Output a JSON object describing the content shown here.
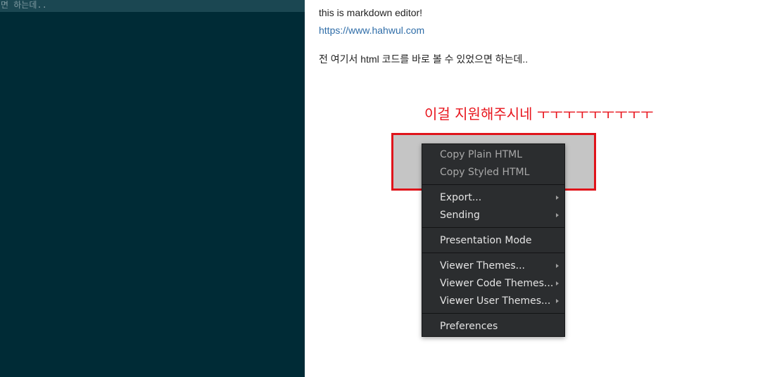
{
  "editor": {
    "visible_line": "면 하는데.."
  },
  "preview": {
    "line1": "this is markdown editor!",
    "link": "https://www.hahwul.com",
    "line2": "전 여기서 html 코드를 바로 볼 수 있었으면 하는데..",
    "annotation": "이걸 지원해주시네 ㅜㅜㅜㅜㅜㅜㅜㅜㅜ"
  },
  "colors": {
    "editor_bg": "#002b36",
    "annotation": "#e8141c",
    "highlight_border": "#e0141b",
    "menu_bg": "#2b2d2f"
  },
  "context_menu": {
    "copy_plain_html": "Copy Plain HTML",
    "copy_styled_html": "Copy Styled HTML",
    "export": "Export...",
    "sending": "Sending",
    "presentation_mode": "Presentation Mode",
    "viewer_themes": "Viewer Themes...",
    "viewer_code_themes": "Viewer Code Themes...",
    "viewer_user_themes": "Viewer User Themes...",
    "preferences": "Preferences"
  }
}
